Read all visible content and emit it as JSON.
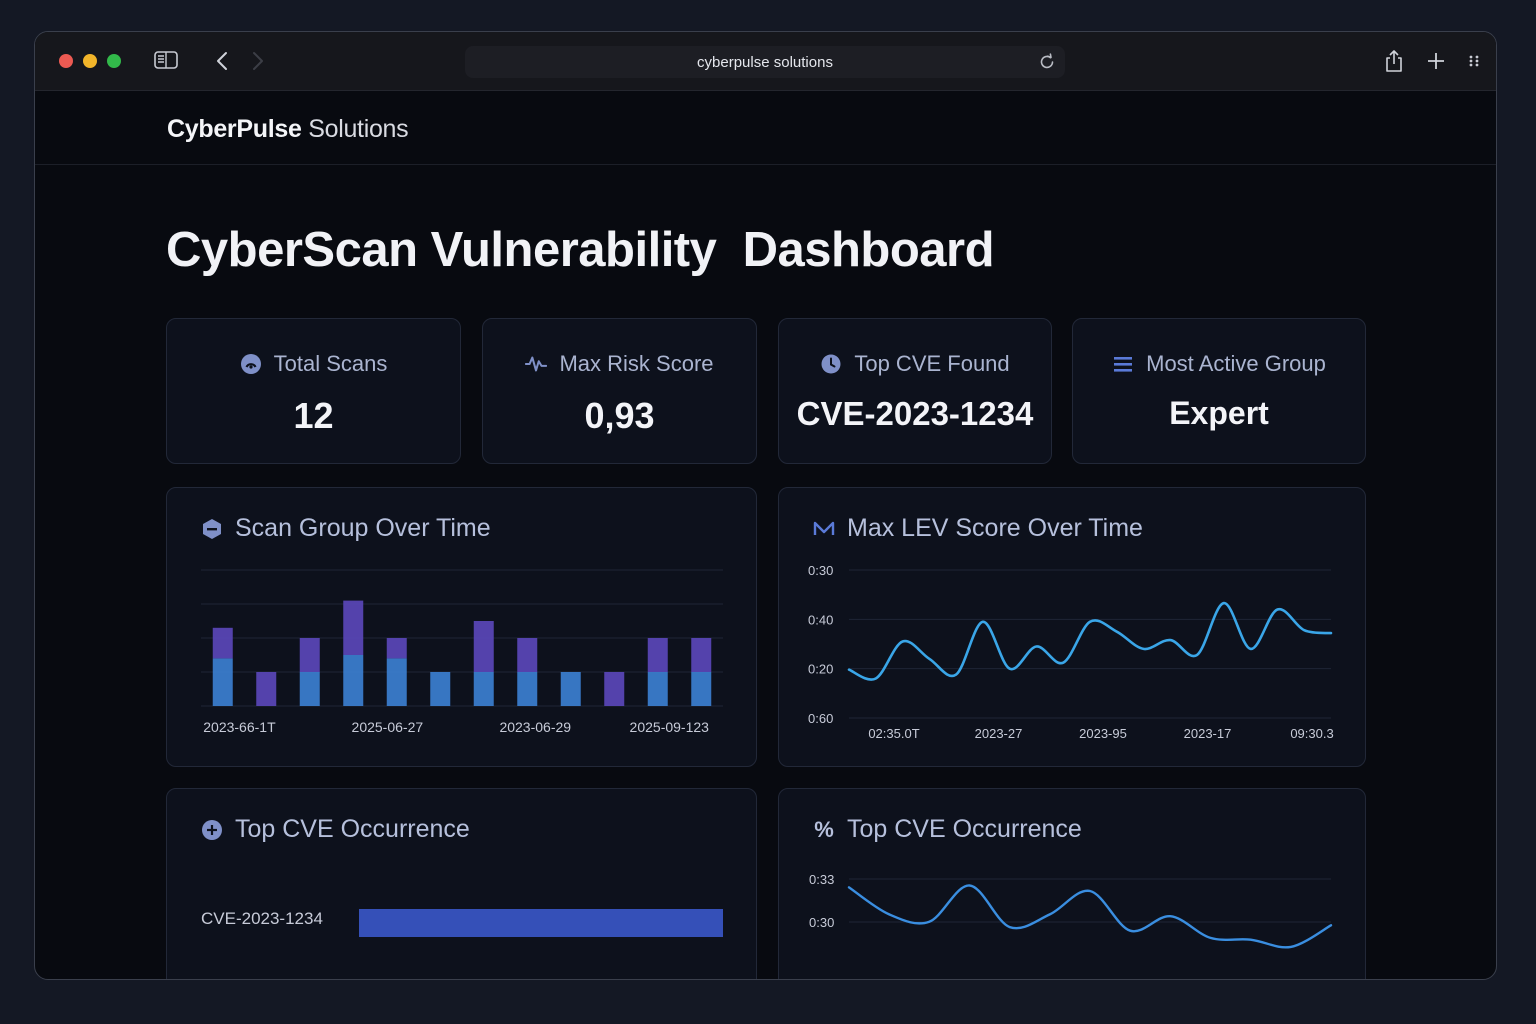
{
  "browser": {
    "address": "cyberpulse solutions"
  },
  "site": {
    "brand_bold": "CyberPulse",
    "brand_light": "Solutions"
  },
  "page": {
    "title": "CyberScan Vulnerability  Dashboard"
  },
  "stats": [
    {
      "label": "Total Scans",
      "value": "12",
      "icon": "gauge-icon"
    },
    {
      "label": "Max Risk Score",
      "value": "0,93",
      "icon": "pulse-icon"
    },
    {
      "label": "Top CVE Found",
      "value": "CVE-2023-1234",
      "icon": "clock-icon"
    },
    {
      "label": "Most Active Group",
      "value": "Expert",
      "icon": "list-icon"
    }
  ],
  "panels": {
    "scan_group": {
      "title": "Scan Group Over Time",
      "icon": "hexagon-icon"
    },
    "max_lev": {
      "title": "Max LEV Score Over Time",
      "icon": "m-icon"
    },
    "top_cve_bar": {
      "title": "Top CVE Occurrence",
      "icon": "plus-circle-icon"
    },
    "top_cve_line": {
      "title": "Top CVE Occurrence",
      "icon": "percent-icon",
      "icon_text": "%"
    }
  },
  "colors": {
    "accent_blue": "#3b7fd0",
    "accent_purple": "#5a47b8",
    "line_blue": "#3aa6e8"
  },
  "chart_data": [
    {
      "type": "bar",
      "title": "Scan Group Over Time",
      "stacked": true,
      "x_tick_labels": [
        "2023-66-1T",
        "2025-06-27",
        "2023-06-29",
        "2025-09-123"
      ],
      "series": [
        {
          "values": [
            1.4,
            0,
            1.0,
            1.5,
            1.4,
            1.0,
            1.0,
            1.0,
            1.0,
            0,
            1.0,
            1.0
          ]
        },
        {
          "values": [
            0.9,
            1.0,
            1.0,
            1.6,
            0.6,
            0,
            1.5,
            1.0,
            0,
            1.0,
            1.0,
            1.0
          ]
        }
      ],
      "ylim": [
        0,
        4
      ]
    },
    {
      "type": "line",
      "title": "Max LEV Score Over Time",
      "y_tick_labels": [
        "0:30",
        "0:40",
        "0:20",
        "0:60"
      ],
      "x_tick_labels": [
        "02:35.0T",
        "2023-27",
        "2023-95",
        "2023-17",
        "09:30.3"
      ],
      "values": [
        0.98,
        0.8,
        1.55,
        1.2,
        0.88,
        1.95,
        1.0,
        1.45,
        1.12,
        1.95,
        1.75,
        1.4,
        1.58,
        1.28,
        2.33,
        1.4,
        2.2,
        1.78,
        1.72
      ],
      "ylim": [
        0,
        3
      ]
    },
    {
      "type": "bar",
      "orientation": "horizontal",
      "title": "Top CVE Occurrence",
      "categories": [
        "CVE-2023-1234"
      ],
      "values": [
        1
      ]
    },
    {
      "type": "line",
      "title": "Top CVE Occurrence",
      "y_tick_labels": [
        "0:33",
        "0:30"
      ],
      "values": [
        0.86,
        0.56,
        0.48,
        0.88,
        0.42,
        0.56,
        0.82,
        0.38,
        0.54,
        0.3,
        0.28,
        0.2,
        0.44
      ],
      "ylim": [
        0,
        1
      ]
    }
  ]
}
